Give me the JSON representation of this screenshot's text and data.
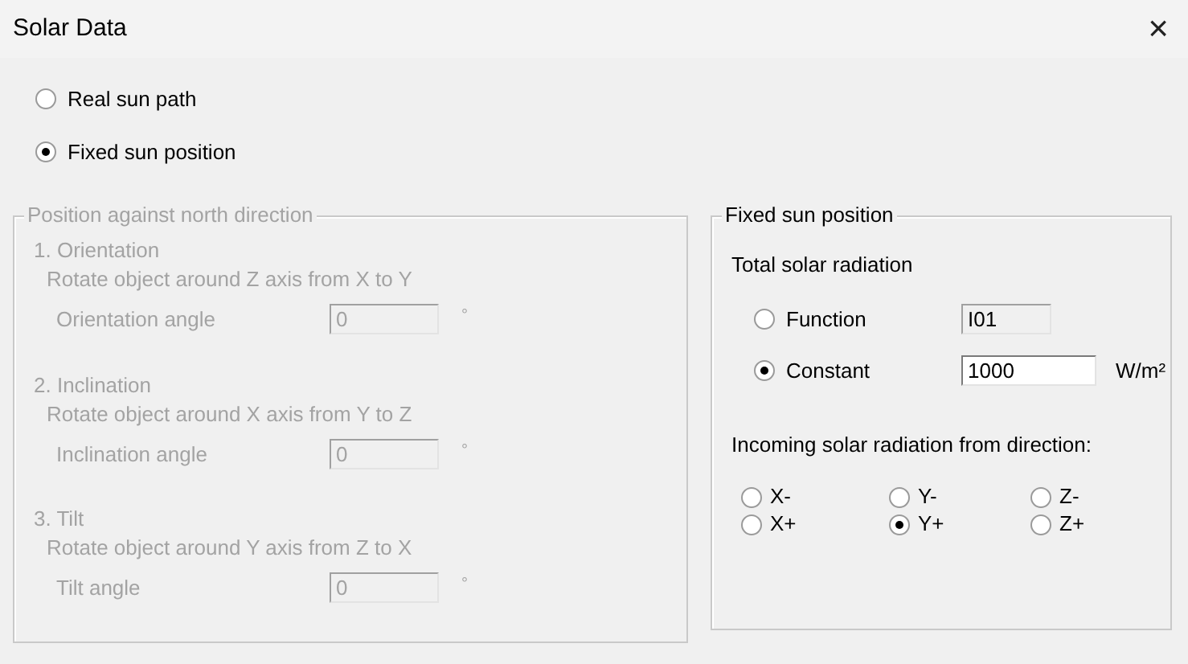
{
  "window": {
    "title": "Solar Data",
    "close": "×"
  },
  "sun_modes": [
    {
      "label": "Real sun path",
      "selected": false
    },
    {
      "label": "Fixed sun position",
      "selected": true
    }
  ],
  "position_group": {
    "title": "Position against north direction",
    "disabled": true,
    "sections": [
      {
        "heading": "1. Orientation",
        "description": "Rotate object around Z axis from X to Y",
        "angle_label": "Orientation angle",
        "value": "0",
        "unit": "°"
      },
      {
        "heading": "2. Inclination",
        "description": "Rotate object around X axis from Y to Z",
        "angle_label": "Inclination angle",
        "value": "0",
        "unit": "°"
      },
      {
        "heading": "3. Tilt",
        "description": "Rotate object around Y axis from Z to X",
        "angle_label": "Tilt angle",
        "value": "0",
        "unit": "°"
      }
    ]
  },
  "fixed_group": {
    "title": "Fixed sun position",
    "total_label": "Total solar radiation",
    "sources": [
      {
        "label": "Function",
        "selected": false,
        "value": "I01",
        "disabled": true
      },
      {
        "label": "Constant",
        "selected": true,
        "value": "1000",
        "disabled": false,
        "unit": "W/m²"
      }
    ],
    "direction_label": "Incoming solar radiation from direction:",
    "directions": [
      {
        "label": "X-",
        "selected": false
      },
      {
        "label": "Y-",
        "selected": false
      },
      {
        "label": "Z-",
        "selected": false
      },
      {
        "label": "X+",
        "selected": false
      },
      {
        "label": "Y+",
        "selected": true
      },
      {
        "label": "Z+",
        "selected": false
      }
    ]
  }
}
